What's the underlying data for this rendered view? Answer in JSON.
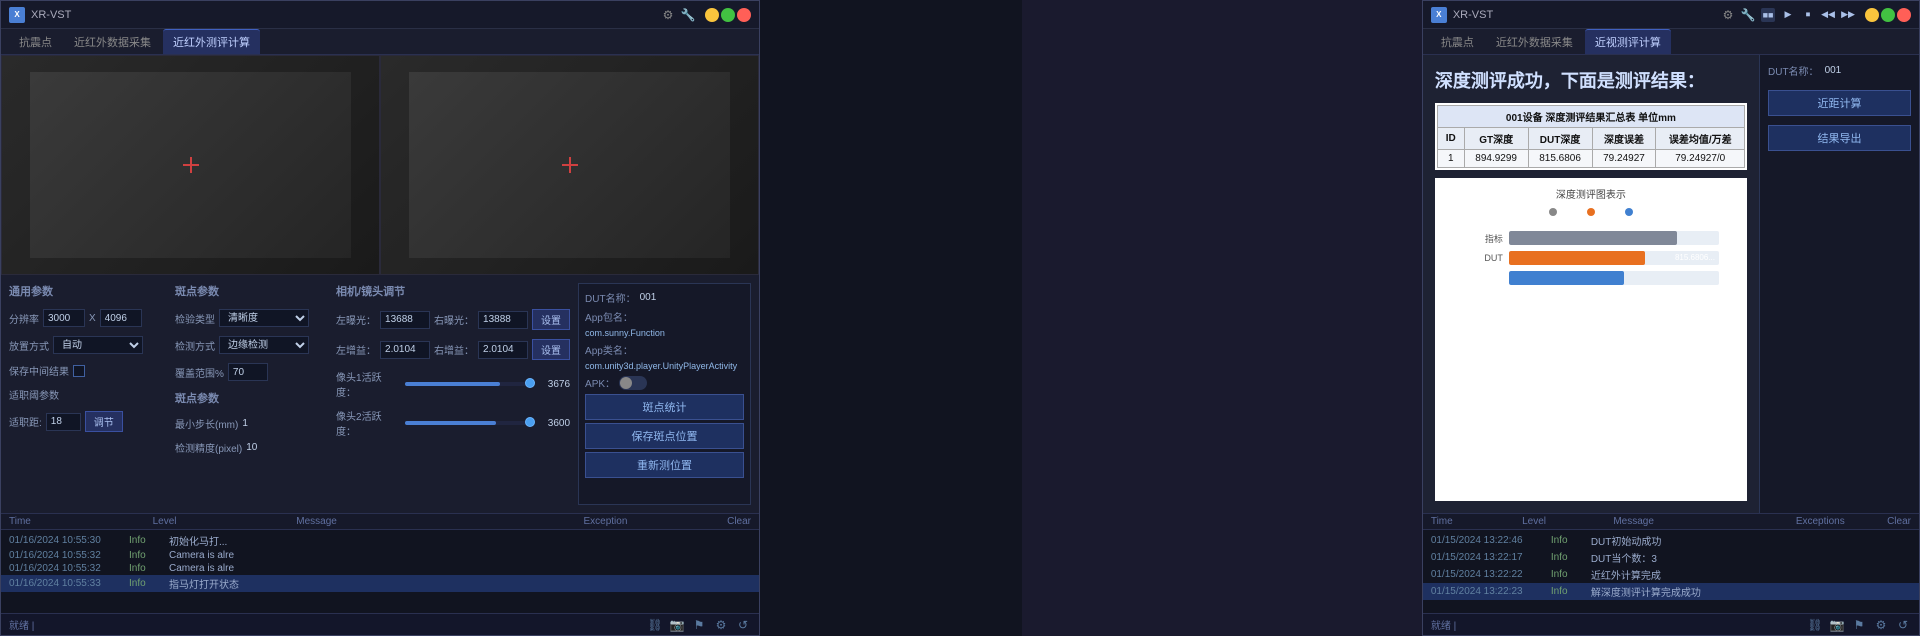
{
  "app": {
    "title": "XR-VST",
    "icon": "X"
  },
  "left_window": {
    "title": "XR-VST",
    "tabs": [
      {
        "label": "抗震点",
        "active": false
      },
      {
        "label": "近红外数据采集",
        "active": false
      },
      {
        "label": "近红外测评计算",
        "active": true
      }
    ],
    "general_params": {
      "title": "通用参数",
      "resolution_label": "分辨率",
      "resolution_w": "3000",
      "resolution_x": "X",
      "resolution_h": "4096",
      "placement_label": "放置方式",
      "placement_value": "自动",
      "save_middle_label": "保存中间结果",
      "threshold_label": "适职阈参数",
      "threshold_val_label": "适职距:",
      "threshold_val": "18",
      "adjust_btn": "调节"
    },
    "spot_params": {
      "title": "斑点参数",
      "detect_type_label": "检验类型",
      "detect_type_value": "清晰度",
      "detect_method_label": "检测方式",
      "detect_method_value": "边缘检测",
      "overlap_label": "覆盖范围%",
      "overlap_value": "70",
      "spot_params_title": "斑点参数",
      "min_step_label": "最小步长(mm)",
      "min_step_value": "1",
      "detect_precision_label": "检测精度(pixel)",
      "detect_precision_value": "10"
    },
    "camera_params": {
      "title": "相机/镜头调节",
      "left_exposure_label": "左曝光：",
      "left_exposure": "13688",
      "right_exposure_label": "右曝光：",
      "right_exposure": "13888",
      "set_btn1": "设置",
      "left_gain_label": "左增益：",
      "left_gain": "2.0104",
      "right_gain_label": "右增益：",
      "right_gain": "2.0104",
      "set_btn2": "设置",
      "cam1_label": "像头1活跃度：",
      "cam1_value": "3676",
      "cam2_label": "像头2活跃度：",
      "cam2_value": "3600"
    },
    "dut_section": {
      "name_label": "DUT名称：",
      "name_value": "001",
      "app_name_label": "App包名：",
      "app_name_value": "com.sunny.Function",
      "app_activity_label": "App类名：",
      "app_activity_value": "com.unity3d.player.UnityPlayerActivity",
      "apk_label": "APK：",
      "spot_btn": "斑点统计",
      "save_spot_btn": "保存斑点位置",
      "restore_btn": "重新测位置"
    },
    "log": {
      "headers": [
        "Time",
        "Level",
        "Message",
        "Exception"
      ],
      "clear_btn": "Clear",
      "entries": [
        {
          "time": "01/16/2024 10:55:30",
          "level": "Info",
          "message": "初始化马打...",
          "exception": ""
        },
        {
          "time": "01/16/2024 10:55:32",
          "level": "Info",
          "message": "Camera is alre",
          "exception": ""
        },
        {
          "time": "01/16/2024 10:55:32",
          "level": "Info",
          "message": "Camera is alre",
          "exception": ""
        },
        {
          "time": "01/16/2024 10:55:33",
          "level": "Info",
          "message": "指马灯打开状态",
          "exception": ""
        }
      ]
    },
    "statusbar": {
      "text": "就绪 |"
    }
  },
  "right_window": {
    "title": "XR-VST",
    "tabs": [
      {
        "label": "抗震点",
        "active": false
      },
      {
        "label": "近红外数据采集",
        "active": false
      },
      {
        "label": "近视测评计算",
        "active": true
      }
    ],
    "result": {
      "title": "深度测评成功，下面是测评结果：",
      "table_title": "001设备 深度测评结果汇总表 单位mm",
      "table_headers": [
        "ID",
        "GT深度",
        "DUT深度",
        "深度误差",
        "误差均值/万差"
      ],
      "table_rows": [
        {
          "id": "1",
          "gt": "894.9299",
          "dut": "815.6806",
          "error": "79.24927",
          "avg": "79.24927/0"
        }
      ],
      "chart_title": "深度测评图表示",
      "dot_labels": [
        "",
        "",
        ""
      ],
      "bars": [
        {
          "label": "指标",
          "fill_pct": 85,
          "type": "gray",
          "value": ""
        },
        {
          "label": "DUT",
          "fill_pct": 70,
          "type": "orange",
          "value": ""
        },
        {
          "label": "",
          "fill_pct": 60,
          "type": "blue",
          "value": ""
        }
      ]
    },
    "dut_panel": {
      "name_label": "DUT名称：",
      "name_value": "001",
      "calc_btn": "近距计算",
      "export_btn": "结果导出"
    },
    "log": {
      "headers": [
        "Time",
        "Level",
        "Message",
        "Exceptions"
      ],
      "clear_btn": "Clear",
      "entries": [
        {
          "time": "01/15/2024 13:22:46",
          "level": "Info",
          "message": "DUT初始动成功",
          "exception": ""
        },
        {
          "time": "01/15/2024 13:22:17",
          "level": "Info",
          "message": "DUT当个数：3",
          "exception": ""
        },
        {
          "time": "01/15/2024 13:22:22",
          "level": "Info",
          "message": "近红外计算完成",
          "exception": ""
        },
        {
          "time": "01/15/2024 13:22:23",
          "level": "Info",
          "message": "解深度测评计算完成成功",
          "exception": ""
        }
      ]
    },
    "statusbar": {
      "text": "就绪 |"
    }
  }
}
